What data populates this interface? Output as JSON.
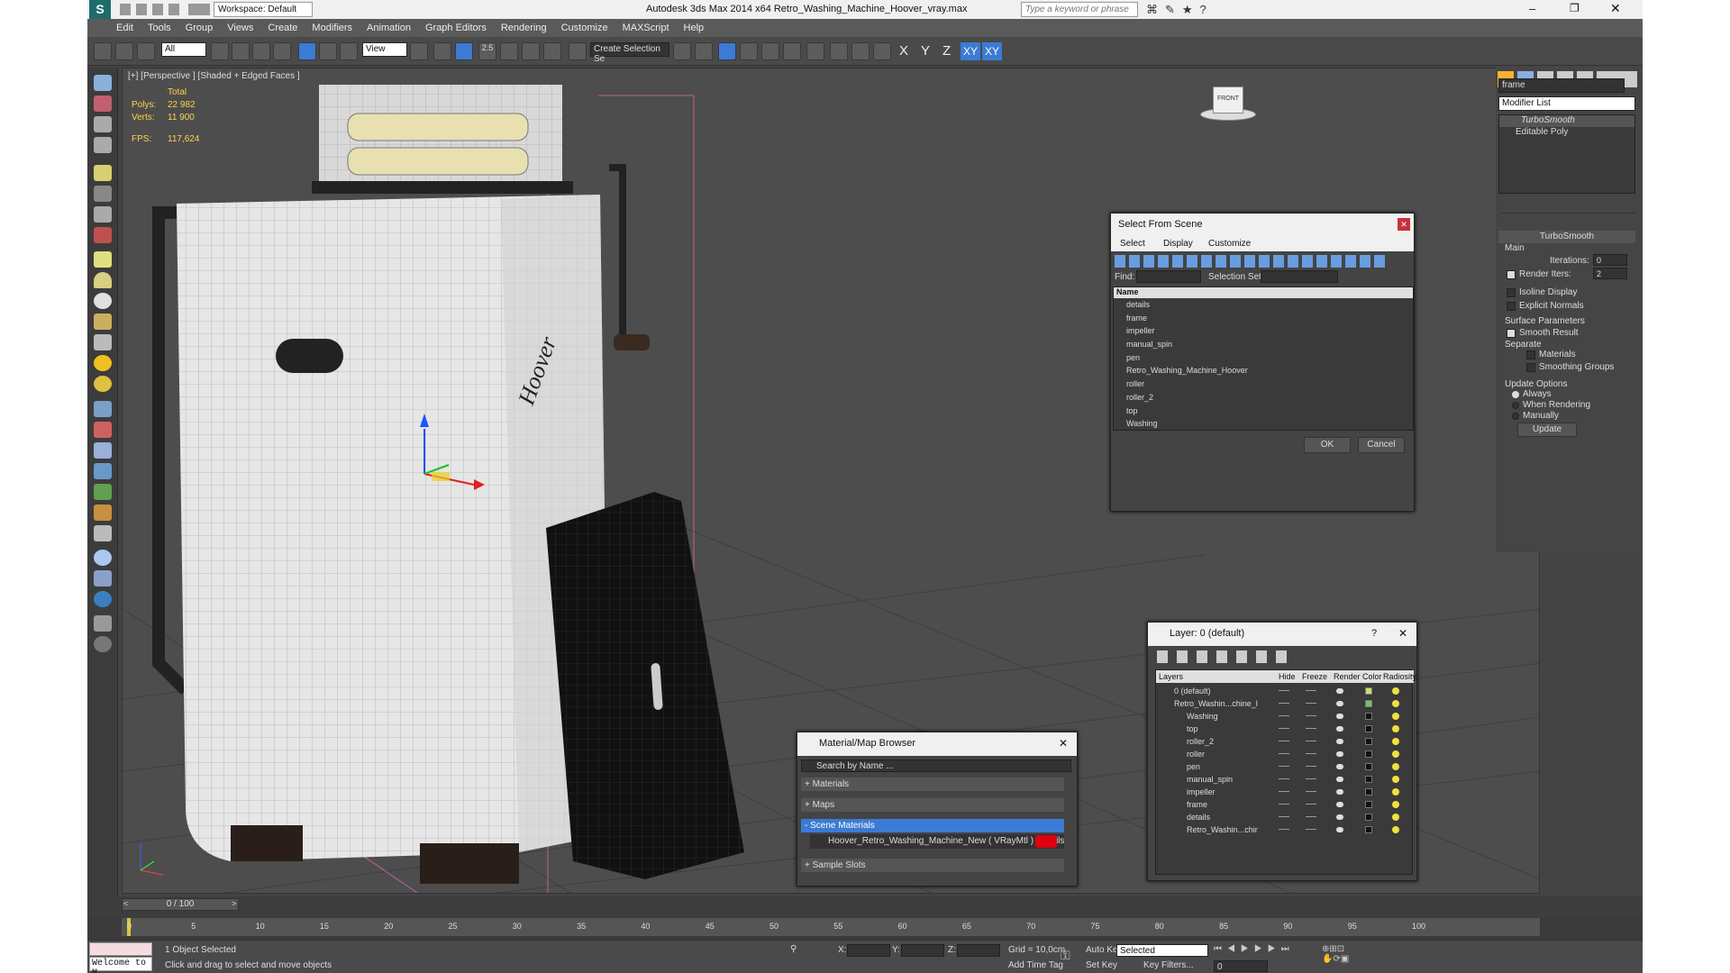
{
  "window": {
    "workspace": "Workspace: Default",
    "title": "Autodesk 3ds Max  2014 x64     Retro_Washing_Machine_Hoover_vray.max",
    "search_placeholder": "Type a keyword or phrase"
  },
  "menu": [
    "Edit",
    "Tools",
    "Group",
    "Views",
    "Create",
    "Modifiers",
    "Animation",
    "Graph Editors",
    "Rendering",
    "Customize",
    "MAXScript",
    "Help"
  ],
  "toolbar": {
    "selection_filter": "All",
    "ref_coord": "View",
    "snap_label": "2.5",
    "named_selection": "Create Selection Se",
    "axis_x": "X",
    "axis_y": "Y",
    "axis_z": "Z",
    "axis_xy": "XY",
    "axis_xy2": "XY"
  },
  "viewport": {
    "label": "[+] [Perspective ] [Shaded + Edged Faces ]",
    "stats_total": "Total",
    "polys_label": "Polys:",
    "polys_value": "22 982",
    "verts_label": "Verts:",
    "verts_value": "11 900",
    "fps_label": "FPS:",
    "fps_value": "117,624",
    "viewcube": "FRONT"
  },
  "command_panel": {
    "object_name": "frame",
    "modifier_list": "Modifier List",
    "stack": [
      "TurboSmooth",
      "Editable Poly"
    ],
    "rollout_title": "TurboSmooth",
    "main_label": "Main",
    "iterations_label": "Iterations:",
    "iterations_value": "0",
    "render_iters_label": "Render Iters:",
    "render_iters_value": "2",
    "isoline": "Isoline Display",
    "explicit_normals": "Explicit Normals",
    "surface_params": "Surface Parameters",
    "smooth_result": "Smooth Result",
    "separate": "Separate",
    "materials": "Materials",
    "smoothing_groups": "Smoothing Groups",
    "update_options": "Update Options",
    "always": "Always",
    "when_rendering": "When Rendering",
    "manually": "Manually",
    "update_button": "Update"
  },
  "select_from_scene": {
    "title": "Select From Scene",
    "tabs": [
      "Select",
      "Display",
      "Customize"
    ],
    "find_label": "Find:",
    "selection_set_label": "Selection Set:",
    "column_name": "Name",
    "items": [
      "details",
      "frame",
      "impeller",
      "manual_spin",
      "pen",
      "Retro_Washing_Machine_Hoover",
      "roller",
      "roller_2",
      "top",
      "Washing"
    ],
    "ok": "OK",
    "cancel": "Cancel"
  },
  "layer_dialog": {
    "title": "Layer: 0 (default)",
    "help": "?",
    "columns": [
      "Layers",
      "Hide",
      "Freeze",
      "Render",
      "Color",
      "Radiosity"
    ],
    "rows": [
      {
        "name": "0 (default)",
        "color": "#c8e06a"
      },
      {
        "name": "Retro_Washin...chine_l",
        "color": "#6ac86a"
      },
      {
        "name": "Washing",
        "color": "#111111"
      },
      {
        "name": "top",
        "color": "#111111"
      },
      {
        "name": "roller_2",
        "color": "#111111"
      },
      {
        "name": "roller",
        "color": "#111111"
      },
      {
        "name": "pen",
        "color": "#111111"
      },
      {
        "name": "manual_spin",
        "color": "#111111"
      },
      {
        "name": "impeller",
        "color": "#111111"
      },
      {
        "name": "frame",
        "color": "#111111"
      },
      {
        "name": "details",
        "color": "#111111"
      },
      {
        "name": "Retro_Washin...chir",
        "color": "#111111"
      }
    ]
  },
  "material_browser": {
    "title": "Material/Map Browser",
    "search_placeholder": "Search by Name ...",
    "sections": [
      "+ Materials",
      "+ Maps",
      "- Scene Materials",
      "+ Sample Slots"
    ],
    "material_item": "Hoover_Retro_Washing_Machine_New ( VRayMtl ) [details, frame,..."
  },
  "timeline": {
    "frame_counter": "0 / 100",
    "ticks": [
      "0",
      "5",
      "10",
      "15",
      "20",
      "25",
      "30",
      "35",
      "40",
      "45",
      "50",
      "55",
      "60",
      "65",
      "70",
      "75",
      "80",
      "85",
      "90",
      "95",
      "100"
    ]
  },
  "status": {
    "welcome": "Welcome to M",
    "selected": "1 Object Selected",
    "prompt": "Click and drag to select and move objects",
    "x_label": "X:",
    "y_label": "Y:",
    "z_label": "Z:",
    "grid": "Grid = 10,0cm",
    "add_time_tag": "Add Time Tag",
    "auto_key": "Auto Key",
    "set_key": "Set Key",
    "selected_dropdown": "Selected",
    "key_filters": "Key Filters...",
    "frame_value": "0"
  }
}
